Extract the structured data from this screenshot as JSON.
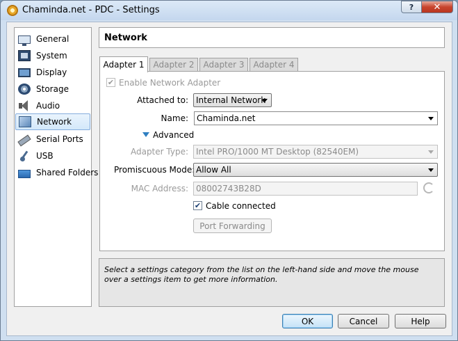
{
  "window": {
    "title": "Chaminda.net - PDC - Settings",
    "help_label": "?",
    "close_label": "✕"
  },
  "sidebar": {
    "items": [
      {
        "label": "General",
        "icon": "general-icon"
      },
      {
        "label": "System",
        "icon": "system-icon"
      },
      {
        "label": "Display",
        "icon": "display-icon"
      },
      {
        "label": "Storage",
        "icon": "storage-icon"
      },
      {
        "label": "Audio",
        "icon": "audio-icon"
      },
      {
        "label": "Network",
        "icon": "network-icon",
        "selected": true
      },
      {
        "label": "Serial Ports",
        "icon": "serial-ports-icon"
      },
      {
        "label": "USB",
        "icon": "usb-icon"
      },
      {
        "label": "Shared Folders",
        "icon": "shared-folders-icon"
      }
    ]
  },
  "header": {
    "title": "Network"
  },
  "tabs": [
    {
      "label": "Adapter 1",
      "active": true
    },
    {
      "label": "Adapter 2"
    },
    {
      "label": "Adapter 3"
    },
    {
      "label": "Adapter 4"
    }
  ],
  "adapter": {
    "enable_label": "Enable Network Adapter",
    "attached_label": "Attached to:",
    "attached_value": "Internal Network",
    "name_label": "Name:",
    "name_value": "Chaminda.net",
    "advanced_label": "Advanced",
    "adapter_type_label": "Adapter Type:",
    "adapter_type_value": "Intel PRO/1000 MT Desktop (82540EM)",
    "promiscuous_label": "Promiscuous Mode:",
    "promiscuous_value": "Allow All",
    "mac_label": "MAC Address:",
    "mac_value": "08002743B28D",
    "cable_label": "Cable connected",
    "port_forwarding_label": "Port Forwarding",
    "check_mark": "✔"
  },
  "info": {
    "text": "Select a settings category from the list on the left-hand side and move the mouse over a settings item to get more information."
  },
  "buttons": {
    "ok": "OK",
    "cancel": "Cancel",
    "help": "Help"
  },
  "colors": {
    "selection_border": "#84acdd",
    "accent_triangle": "#2f7fc1",
    "close_button": "#c8452e"
  }
}
